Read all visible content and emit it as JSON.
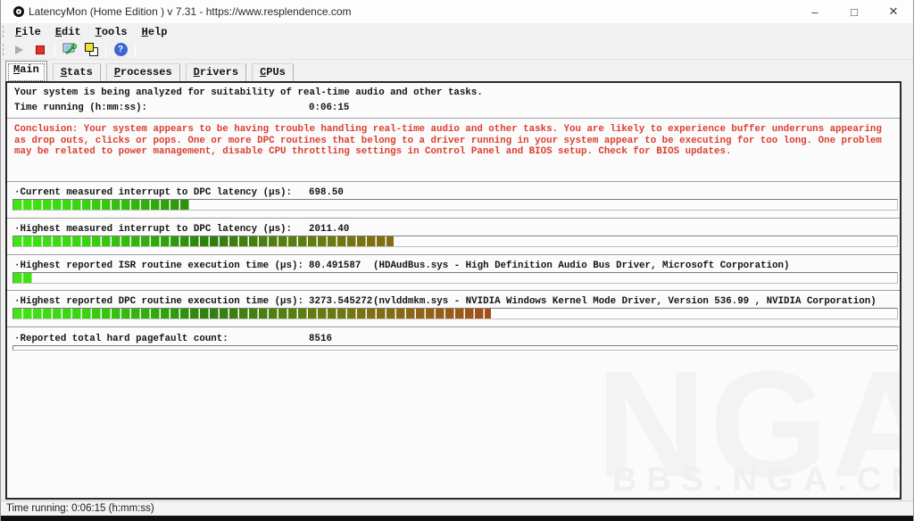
{
  "window": {
    "title": "LatencyMon (Home Edition ) v 7.31 - https://www.resplendence.com",
    "controls": {
      "minimize": "–",
      "maximize": "□",
      "close": "✕"
    }
  },
  "menu": {
    "items": [
      "File",
      "Edit",
      "Tools",
      "Help"
    ]
  },
  "toolbar": {
    "buttons": [
      "start",
      "stop",
      "options",
      "report",
      "help"
    ],
    "help_glyph": "?"
  },
  "tabs": [
    {
      "label": "Main",
      "selected": true
    },
    {
      "label": "Stats",
      "selected": false
    },
    {
      "label": "Processes",
      "selected": false
    },
    {
      "label": "Drivers",
      "selected": false
    },
    {
      "label": "CPUs",
      "selected": false
    }
  ],
  "header": {
    "line1": "Your system is being analyzed for suitability of real-time audio and other tasks.",
    "time_label": "Time running (h:mm:ss):",
    "time_value": "0:06:15"
  },
  "conclusion": "Conclusion: Your system appears to be having trouble handling real-time audio and other tasks. You are likely to experience buffer underruns appearing as drop outs, clicks or pops. One or more DPC routines that belong to a driver running in your system appear to be executing for too long. One problem may be related to power management, disable CPU throttling settings in Control Panel and BIOS setup. Check for BIOS updates.",
  "measurements": [
    {
      "label": "·Current measured interrupt to DPC latency (µs):",
      "value": "698.50",
      "info": "",
      "fill_percent": 20
    },
    {
      "label": "·Highest measured interrupt to DPC latency (µs):",
      "value": "2011.40",
      "info": "",
      "fill_percent": 43
    },
    {
      "label": "·Highest reported ISR routine execution time (µs):",
      "value": "80.491587",
      "info": "(HDAudBus.sys - High Definition Audio Bus Driver, Microsoft Corporation)",
      "fill_percent": 2.2
    },
    {
      "label": "·Highest reported DPC routine execution time (µs):",
      "value": "3273.545272",
      "info": "(nvlddmkm.sys - NVIDIA Windows Kernel Mode Driver, Version 536.99 , NVIDIA Corporation)",
      "fill_percent": 54
    },
    {
      "label": "·Reported total hard pagefault count:",
      "value": "8516",
      "info": "",
      "fill_percent": 0
    }
  ],
  "status_bar": {
    "text": "Time running: 0:06:15  (h:mm:ss)"
  },
  "watermark": {
    "big": "NGA",
    "small": "BBS.NGA.CN"
  },
  "colors": {
    "alert_red": "#dc3d2f",
    "bar_green_start": "#3fe712",
    "bar_green_dark": "#2e7f0c",
    "bar_olive": "#747610",
    "bar_red_end": "#b23a1f",
    "stop_button_red": "#e63225",
    "help_blue": "#3a66d4"
  }
}
